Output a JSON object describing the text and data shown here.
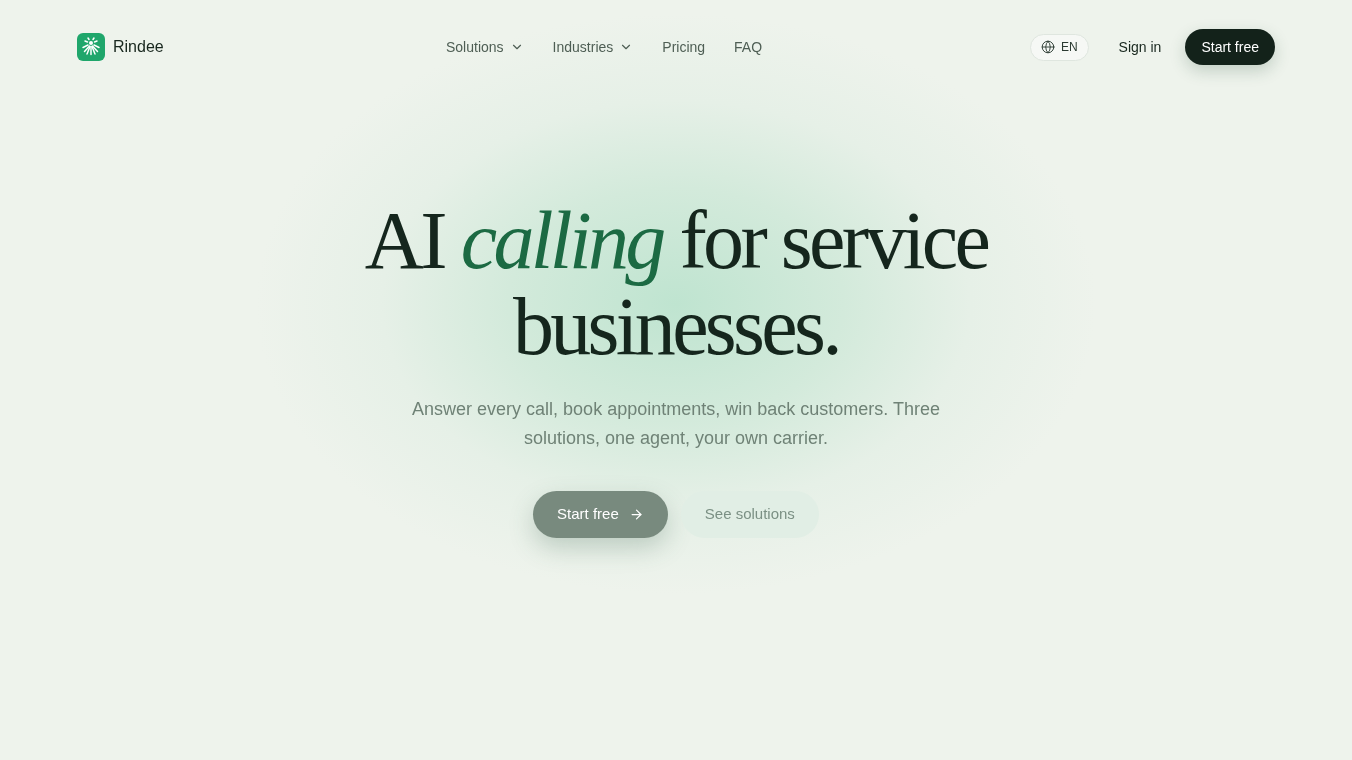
{
  "brand": {
    "name": "Rindee"
  },
  "nav": {
    "links": [
      {
        "label": "Solutions",
        "has_menu": true
      },
      {
        "label": "Industries",
        "has_menu": true
      },
      {
        "label": "Pricing",
        "has_menu": false
      },
      {
        "label": "FAQ",
        "has_menu": false
      }
    ]
  },
  "actions": {
    "language": "EN",
    "sign_in": "Sign in",
    "cta": "Start free"
  },
  "hero": {
    "headline": "AI *calling* for service businesses.",
    "subtitle": "Answer every call, book appointments, win back customers. Three solutions, one agent, your own carrier.",
    "buttons": [
      {
        "label": "Start free",
        "kind": "primary"
      },
      {
        "label": "See solutions",
        "kind": "secondary"
      }
    ]
  }
}
